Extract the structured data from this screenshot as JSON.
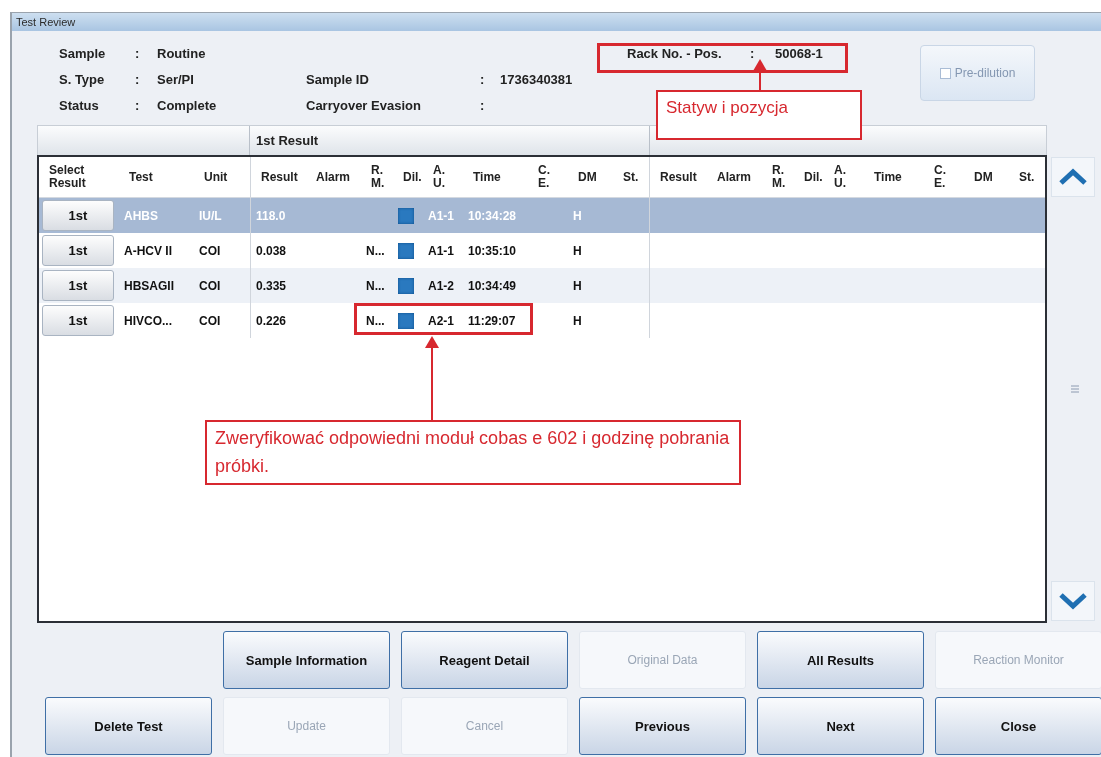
{
  "window": {
    "title": "Test Review"
  },
  "info": [
    {
      "label": "Sample",
      "colon": ":",
      "value": "Routine"
    },
    {
      "label": "S. Type",
      "colon": ":",
      "value": "Ser/PI"
    },
    {
      "label": "Status",
      "colon": ":",
      "value": "Complete"
    },
    {
      "label": "Sample ID",
      "colon": ":",
      "value": "1736340381"
    },
    {
      "label": "Carryover Evasion",
      "colon": ":"
    },
    {
      "label": "Rack No. - Pos.",
      "colon": ":",
      "value": "50068-1"
    }
  ],
  "pre_dilution": {
    "label": "Pre-dilution",
    "checked": false,
    "disabled": true
  },
  "table": {
    "group_title": "1st Result",
    "columns": [
      {
        "label": "Select Result"
      },
      {
        "label": "Test"
      },
      {
        "label": "Unit"
      },
      {
        "label": "Result"
      },
      {
        "label": "Alarm"
      },
      {
        "label": "R. M."
      },
      {
        "label": "Dil."
      },
      {
        "label": "A. U."
      },
      {
        "label": "Time"
      },
      {
        "label": "C. E."
      },
      {
        "label": "DM"
      },
      {
        "label": "St."
      },
      {
        "label": "Result"
      },
      {
        "label": "Alarm"
      },
      {
        "label": "R. M."
      },
      {
        "label": "Dil."
      },
      {
        "label": "A. U."
      },
      {
        "label": "Time"
      },
      {
        "label": "C. E."
      },
      {
        "label": "DM"
      },
      {
        "label": "St."
      }
    ],
    "rows": [
      {
        "selected": true,
        "select": "1st",
        "test": "AHBS",
        "unit": "IU/L",
        "result": "118.0",
        "au": "A1-1",
        "time": "10:34:28",
        "dm": "H"
      },
      {
        "selected": false,
        "select": "1st",
        "test": "A-HCV II",
        "unit": "COI",
        "result": "0.038",
        "rm": "N...",
        "au": "A1-1",
        "time": "10:35:10",
        "dm": "H"
      },
      {
        "selected": false,
        "select": "1st",
        "test": "HBSAGII",
        "unit": "COI",
        "result": "0.335",
        "rm": "N...",
        "au": "A1-2",
        "time": "10:34:49",
        "dm": "H"
      },
      {
        "selected": false,
        "select": "1st",
        "test": "HIVCO...",
        "unit": "COI",
        "result": "0.226",
        "rm": "N...",
        "au": "A2-1",
        "time": "11:29:07",
        "dm": "H"
      }
    ]
  },
  "buttons_top": [
    {
      "label": "Sample Information",
      "disabled": false
    },
    {
      "label": "Reagent Detail",
      "disabled": false
    },
    {
      "label": "Original Data",
      "disabled": true
    },
    {
      "label": "All Results",
      "disabled": false
    },
    {
      "label": "Reaction Monitor",
      "disabled": true
    }
  ],
  "buttons_bottom": [
    {
      "label": "Delete Test",
      "disabled": false
    },
    {
      "label": "Update",
      "disabled": true
    },
    {
      "label": "Cancel",
      "disabled": true
    },
    {
      "label": "Previous",
      "disabled": false
    },
    {
      "label": "Next",
      "disabled": false
    },
    {
      "label": "Close",
      "disabled": false
    }
  ],
  "annotations": [
    {
      "kind": "note",
      "text": "Statyw i pozycja"
    },
    {
      "kind": "note",
      "text": "Zweryfikować odpowiedni moduł cobas e 602 i godzinę pobrania próbki."
    }
  ]
}
